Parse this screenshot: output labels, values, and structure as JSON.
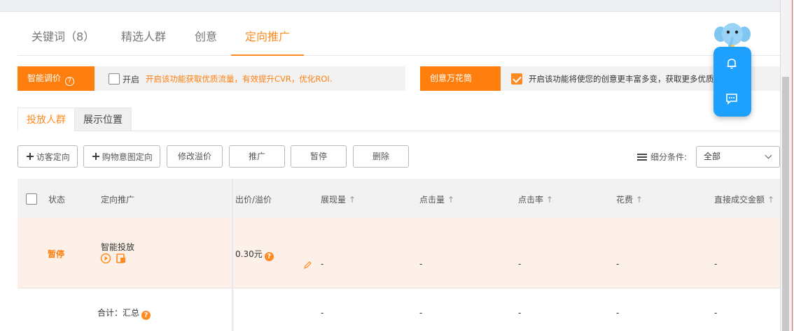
{
  "main_tabs": [
    {
      "label": "关键词（8）",
      "active": false
    },
    {
      "label": "精选人群",
      "active": false
    },
    {
      "label": "创意",
      "active": false
    },
    {
      "label": "定向推广",
      "active": true
    }
  ],
  "smart_bid": {
    "tag_label": "智能调价",
    "checkbox_label": "开启",
    "checked": false,
    "description": "开启该功能获取优质流量，有效提升CVR，优化ROI."
  },
  "creative": {
    "tag_label": "创意万花筒",
    "checked": true,
    "description": "开启该功能将使您的创意更丰富多变，获取更多优质推广流量。"
  },
  "sub_tabs": [
    {
      "label": "投放人群",
      "active": true
    },
    {
      "label": "展示位置",
      "active": false
    }
  ],
  "toolbar": {
    "visitor_targeting": "访客定向",
    "purchase_intent": "购物意图定向",
    "modify_premium": "修改溢价",
    "promote": "推广",
    "pause": "暂停",
    "delete": "删除",
    "filter_label": "细分条件:",
    "filter_value": "全部"
  },
  "table": {
    "headers": {
      "status": "状态",
      "targeting": "定向推广",
      "bid": "出价/溢价",
      "impressions": "展现量",
      "clicks": "点击量",
      "ctr": "点击率",
      "cost": "花费",
      "direct_gmv": "直接成交金额"
    },
    "sort_arrow": "↑",
    "rows": [
      {
        "status": "暂停",
        "targeting": "智能投放",
        "bid": "0.30元",
        "impressions": "-",
        "clicks": "-",
        "ctr": "-",
        "cost": "-",
        "direct_gmv": "-"
      }
    ],
    "total": {
      "label": "合计：汇总",
      "impressions": "-",
      "clicks": "-",
      "ctr": "-",
      "cost": "-",
      "direct_gmv": "-"
    }
  },
  "colors": {
    "accent": "#ff8a1f",
    "tag_bg": "#ff7f0e",
    "float_panel": "#1ea0ff",
    "row_highlight": "#fdf0e8"
  },
  "icons": {
    "help": "help-circle-icon",
    "bell": "bell-icon",
    "chat": "chat-bubble-icon",
    "mascot": "elephant-mascot-icon",
    "edit": "pencil-icon",
    "play": "play-circle-icon",
    "device": "device-icon"
  }
}
